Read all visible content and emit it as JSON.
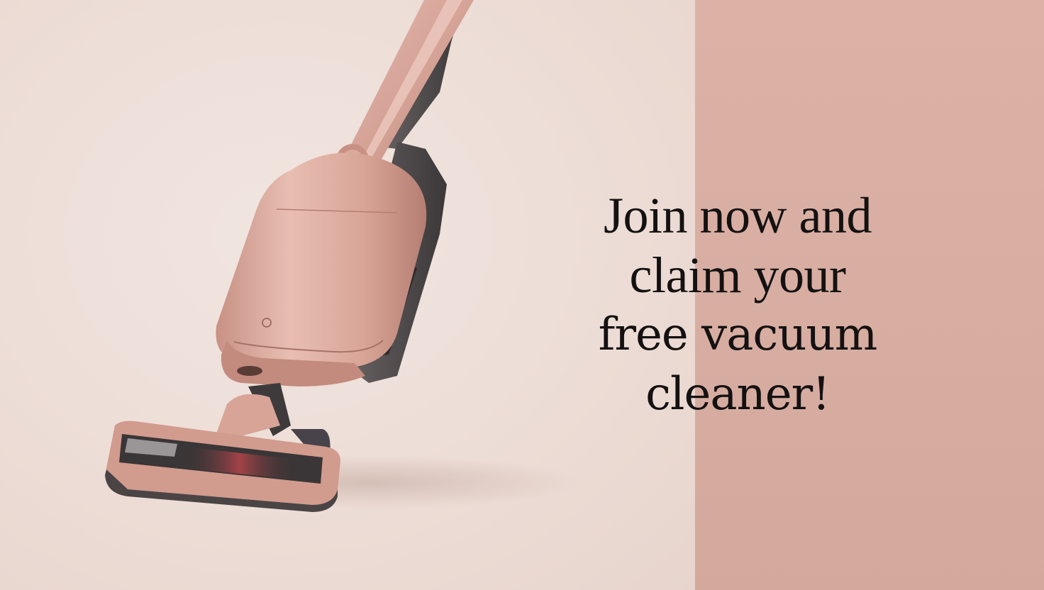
{
  "headline": {
    "line1": "Join now and",
    "line2": "claim your",
    "line3": "free vacuum",
    "line4": "cleaner!"
  },
  "colors": {
    "background_left": "#ede0da",
    "background_right": "#d8aea2",
    "product_rose_gold": "#d9a89c",
    "product_dark_grey": "#4a4647",
    "text": "#141111"
  }
}
